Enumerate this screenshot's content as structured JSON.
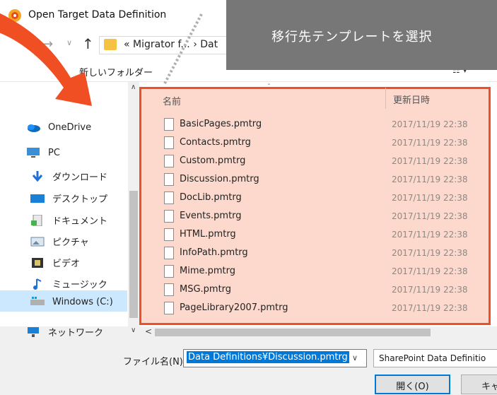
{
  "window": {
    "title": "Open Target Data Definition"
  },
  "toolbar": {
    "address_prefix": "«",
    "address_crumb1": "Migrator f...",
    "address_sep": "›",
    "address_crumb2": "Dat"
  },
  "cmdbar": {
    "new_folder": "新しいフォルダー",
    "view_icon": "☷ ▾"
  },
  "overlay": {
    "caption": "移行先テンプレートを選択"
  },
  "sidebar": {
    "items": [
      {
        "label": "OneDrive",
        "icon": "cloud-icon"
      },
      {
        "label": "PC",
        "icon": "computer-icon"
      },
      {
        "label": "ダウンロード",
        "icon": "download-arrow-icon"
      },
      {
        "label": "デスクトップ",
        "icon": "desktop-icon"
      },
      {
        "label": "ドキュメント",
        "icon": "document-icon"
      },
      {
        "label": "ピクチャ",
        "icon": "pictures-icon"
      },
      {
        "label": "ビデオ",
        "icon": "video-icon"
      },
      {
        "label": "ミュージック",
        "icon": "music-icon"
      },
      {
        "label": "Windows (C:)",
        "icon": "drive-icon"
      },
      {
        "label": "ネットワーク",
        "icon": "network-icon"
      }
    ]
  },
  "filelist": {
    "col_name": "名前",
    "col_date": "更新日時",
    "files": [
      {
        "name": "BasicPages.pmtrg",
        "date": "2017/11/19 22:38"
      },
      {
        "name": "Contacts.pmtrg",
        "date": "2017/11/19 22:38"
      },
      {
        "name": "Custom.pmtrg",
        "date": "2017/11/19 22:38"
      },
      {
        "name": "Discussion.pmtrg",
        "date": "2017/11/19 22:38"
      },
      {
        "name": "DocLib.pmtrg",
        "date": "2017/11/19 22:38"
      },
      {
        "name": "Events.pmtrg",
        "date": "2017/11/19 22:38"
      },
      {
        "name": "HTML.pmtrg",
        "date": "2017/11/19 22:38"
      },
      {
        "name": "InfoPath.pmtrg",
        "date": "2017/11/19 22:38"
      },
      {
        "name": "Mime.pmtrg",
        "date": "2017/11/19 22:38"
      },
      {
        "name": "MSG.pmtrg",
        "date": "2017/11/19 22:38"
      },
      {
        "name": "PageLibrary2007.pmtrg",
        "date": "2017/11/19 22:38"
      }
    ]
  },
  "bottom": {
    "filename_label": "ファイル名(N):",
    "filename_value": "Data Definitions¥Discussion.pmtrg",
    "filetype_value": "SharePoint Data Definitio",
    "open_label": "開く(O)",
    "cancel_label": "キャ"
  },
  "colors": {
    "accent": "#f04e23",
    "highlight_fill": "#fcd9cc",
    "select": "#0078d7"
  }
}
